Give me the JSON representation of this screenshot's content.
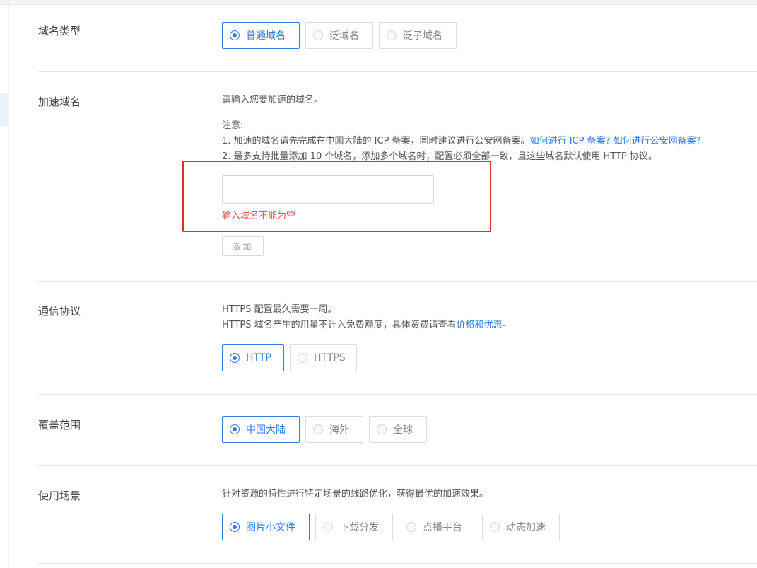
{
  "domain_type": {
    "label": "域名类型",
    "options": [
      "普通域名",
      "泛域名",
      "泛子域名"
    ],
    "selected_index": 0
  },
  "accel_domain": {
    "label": "加速域名",
    "hint": "请输入您要加速的域名。",
    "note_title": "注意:",
    "note1_text": "1. 加速的域名请先完成在中国大陆的 ICP 备案，同时建议进行公安网备案。",
    "note1_link1": "如何进行 ICP 备案?",
    "note1_link2": "如何进行公安网备案?",
    "note2_text": "2. 最多支持批量添加 10 个域名，添加多个域名时，配置必须全部一致，且这些域名默认使用 HTTP 协议。",
    "input_value": "",
    "input_placeholder": "",
    "error": "输入域名不能为空",
    "add_button": "添加"
  },
  "protocol": {
    "label": "通信协议",
    "line1": "HTTPS 配置最久需要一周。",
    "line2_text": "HTTPS 域名产生的用量不计入免费额度，具体资费请查看",
    "line2_link": "价格和优惠",
    "line2_end": "。",
    "options": [
      "HTTP",
      "HTTPS"
    ],
    "selected_index": 0
  },
  "coverage": {
    "label": "覆盖范围",
    "options": [
      "中国大陆",
      "海外",
      "全球"
    ],
    "selected_index": 0
  },
  "scenario": {
    "label": "使用场景",
    "hint": "针对资源的特性进行特定场景的线路优化，获得最优的加速效果。",
    "options": [
      "图片小文件",
      "下载分发",
      "点播平台",
      "动态加速"
    ],
    "selected_index": 0
  },
  "colors": {
    "accent": "#2f7ce8",
    "error": "#e0514b",
    "highlight": "#e02d2d"
  }
}
